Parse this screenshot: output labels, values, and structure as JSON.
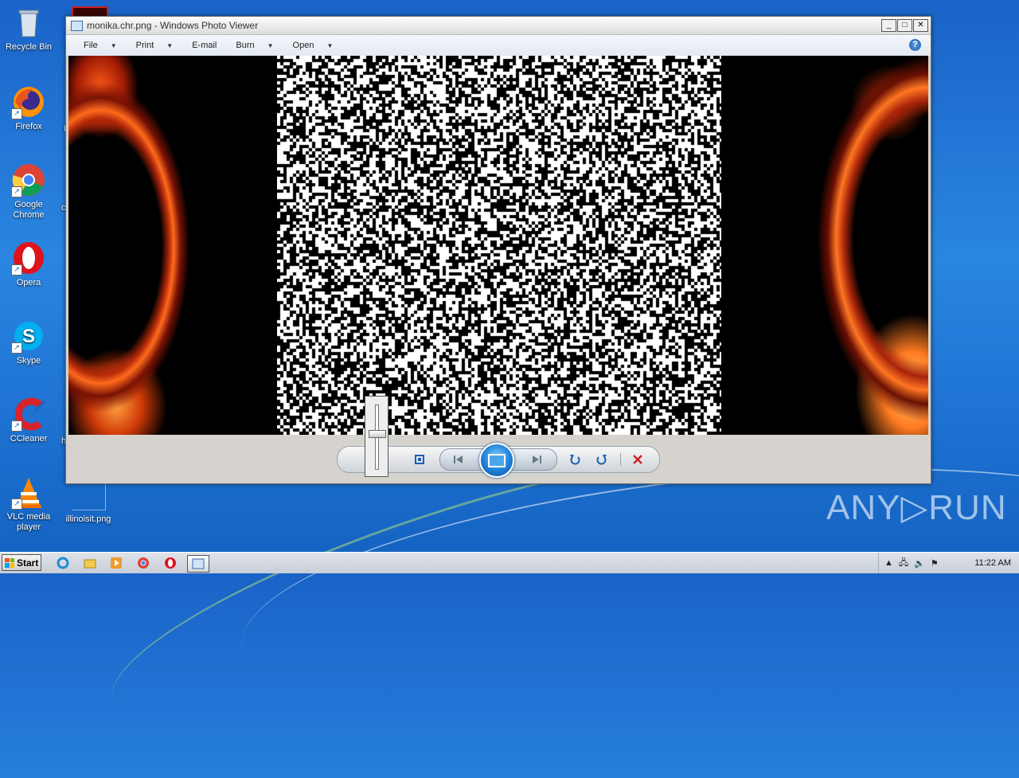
{
  "window": {
    "title": "monika.chr.png - Windows Photo Viewer",
    "min_label": "_",
    "max_label": "□",
    "close_label": "✕"
  },
  "menu": {
    "items": [
      {
        "label": "File"
      },
      {
        "label": "Print"
      },
      {
        "label": "E-mail"
      },
      {
        "label": "Burn"
      },
      {
        "label": "Open"
      }
    ],
    "help": "?"
  },
  "desktop": {
    "icons": [
      {
        "label": "Recycle Bin",
        "icon": "recycle-bin-icon"
      },
      {
        "label": "Firefox",
        "icon": "firefox-icon"
      },
      {
        "label": "Google Chrome",
        "icon": "chrome-icon"
      },
      {
        "label": "Opera",
        "icon": "opera-icon"
      },
      {
        "label": "Skype",
        "icon": "skype-icon"
      },
      {
        "label": "CCleaner",
        "icon": "ccleaner-icon"
      },
      {
        "label": "VLC media player",
        "icon": "vlc-icon"
      },
      {
        "label": "illinoisit.png",
        "icon": "image-file-icon"
      }
    ],
    "partial_labels": [
      "F",
      "c",
      "h"
    ]
  },
  "taskbar": {
    "start_label": "Start",
    "clock": "11:22 AM"
  },
  "watermark": "ANY▷RUN",
  "colors": {
    "desktop_blue": "#1f74d4",
    "window_gray": "#d6d3ce",
    "accent_blue": "#1f7fd8",
    "delete_red": "#cc2222"
  }
}
